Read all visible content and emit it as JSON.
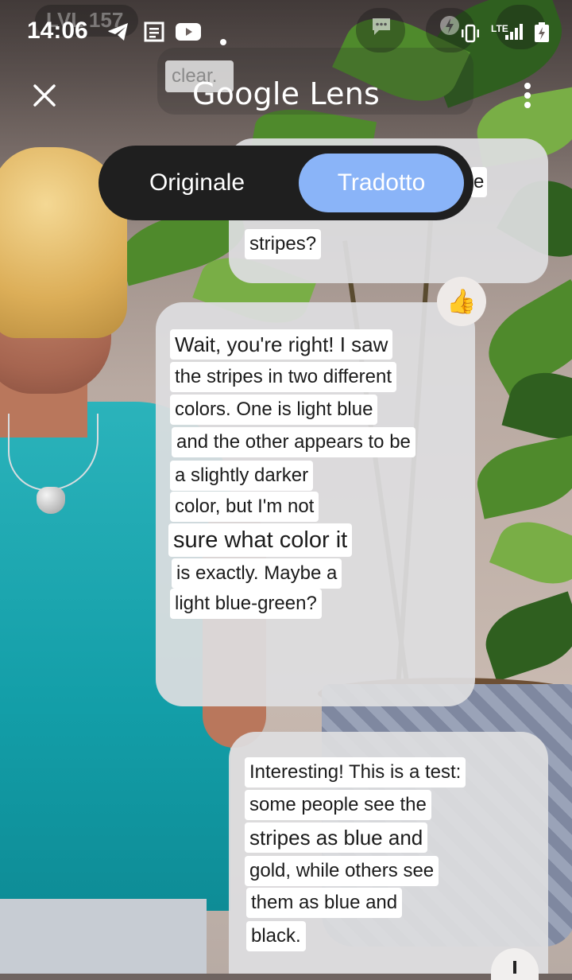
{
  "status_bar": {
    "time": "14:06",
    "icons": [
      "telegram-icon",
      "document-scan-icon",
      "youtube-icon",
      "dot-icon",
      "vibrate-icon",
      "lte-icon",
      "signal-icon",
      "battery-icon"
    ],
    "network_label": "LTE"
  },
  "background_labels": {
    "level_badge": "LVL 157",
    "clear_badge": "clear."
  },
  "header": {
    "title": "Google Lens",
    "close_icon": "close-icon",
    "more_icon": "more-vert-icon"
  },
  "mode_toggle": {
    "original": "Originale",
    "translated": "Tradotto",
    "selected": "Tradotto",
    "selected_color": "#8ab4f8"
  },
  "messages": [
    {
      "side": "right",
      "lines": [
        "e",
        "stripes?"
      ]
    },
    {
      "side": "left",
      "reaction": "👍",
      "lines": [
        "Wait, you're right! I saw",
        "the stripes in two different",
        "colors. One is light blue",
        "and the other appears to be",
        "a slightly darker",
        "color, but I'm not",
        "sure what color it",
        "is exactly. Maybe a",
        "light blue-green?"
      ]
    },
    {
      "side": "right",
      "lines": [
        "Interesting! This is a test:",
        "some people see the",
        "stripes as blue and",
        "gold, while others see",
        "them as blue and",
        "black."
      ]
    }
  ]
}
